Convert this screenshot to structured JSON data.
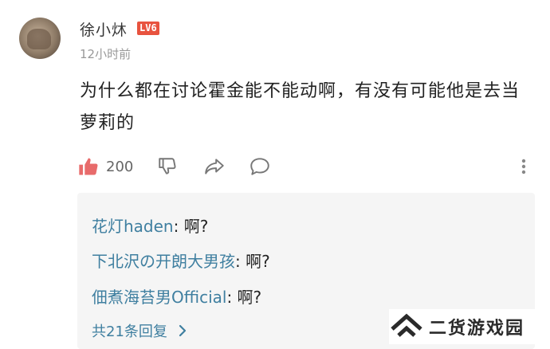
{
  "comment": {
    "username": "徐小炑",
    "level": "LV6",
    "time": "12小时前",
    "text": "为什么都在讨论霍金能不能动啊，有没有可能他是去当萝莉的"
  },
  "actions": {
    "like_count": "200"
  },
  "replies": [
    {
      "author": "花灯haden",
      "text": ": 啊?"
    },
    {
      "author": "下北沢の开朗大男孩",
      "text": ": 啊?"
    },
    {
      "author": "佃煮海苔男Official",
      "text": ": 啊?"
    }
  ],
  "replies_total": "共21条回复",
  "watermark": {
    "text": "二货游戏园"
  },
  "colors": {
    "accent_like": "#e86b6b",
    "level_badge": "#e8533f",
    "link": "#3f7fa0",
    "reply_bg": "#f5f5f5"
  },
  "icons": [
    "thumbs-up-icon",
    "thumbs-down-icon",
    "share-icon",
    "comment-icon",
    "more-vertical-icon",
    "chevron-right-icon",
    "watermark-logo-icon"
  ]
}
